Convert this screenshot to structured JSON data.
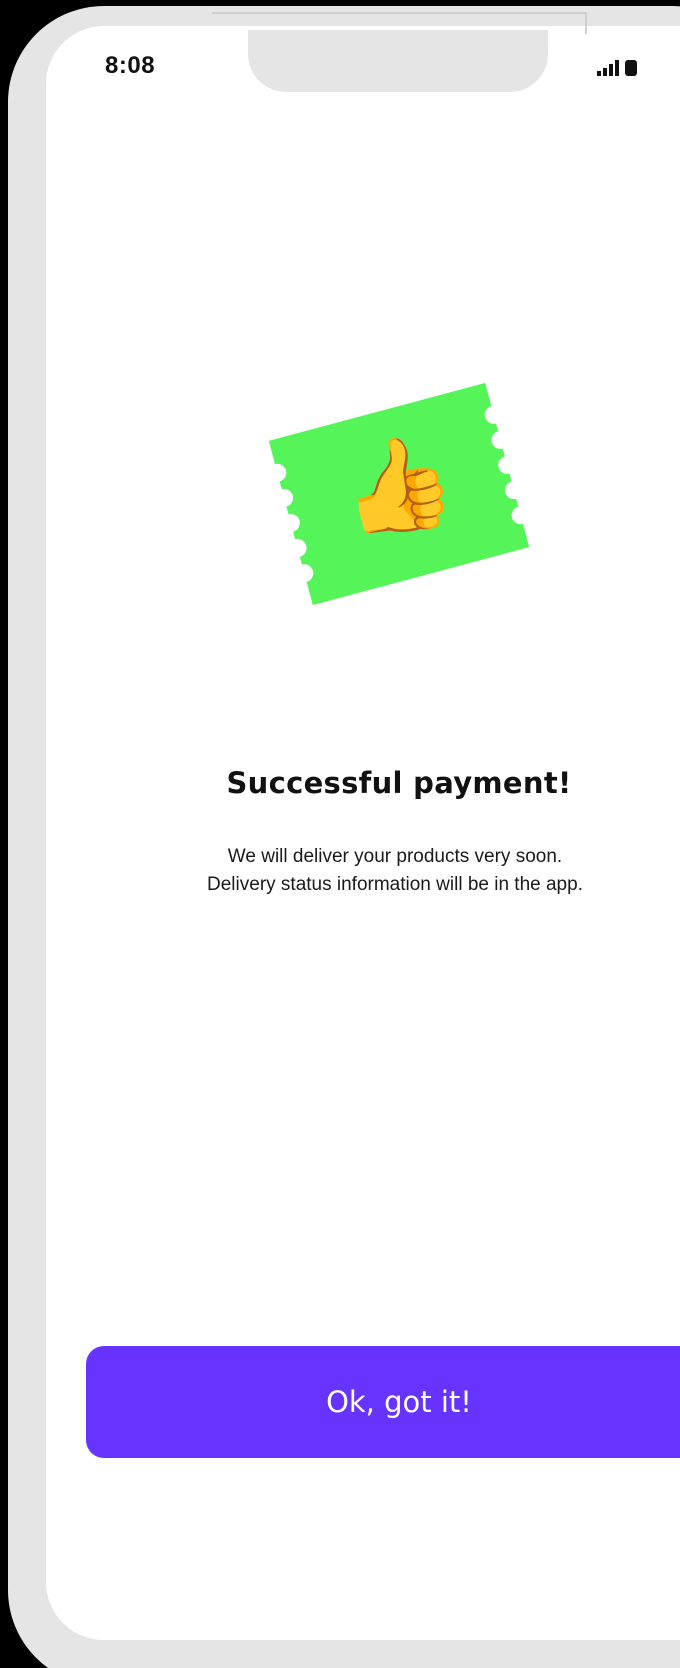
{
  "status_bar": {
    "time": "8:08"
  },
  "illustration": {
    "ticket_color": "#55f55a",
    "emoji": "👍",
    "icon": "thumbs-up-icon"
  },
  "message": {
    "title": "Successful payment!",
    "line1": "We will deliver your products very soon.",
    "line2": "Delivery status information will be in the app."
  },
  "primary_button": {
    "label": "Ok, got it!",
    "color": "#6633ff"
  }
}
